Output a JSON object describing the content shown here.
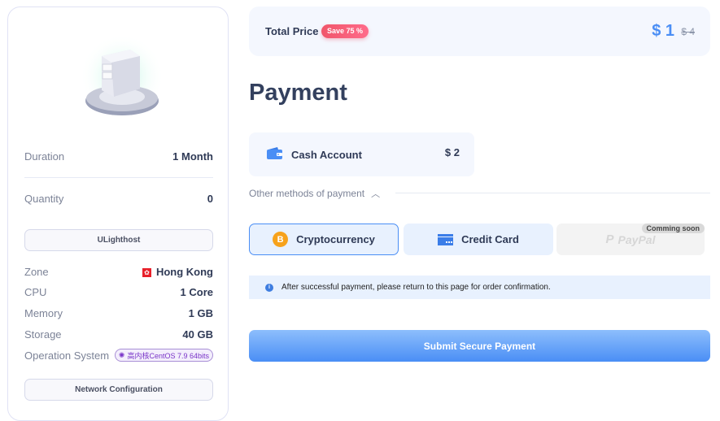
{
  "product": {
    "image_icon": "server-icon",
    "specs_top": [
      {
        "label": "Duration",
        "value": "1 Month"
      },
      {
        "label": "Quantity",
        "value": "0"
      }
    ],
    "provider_button": "ULighthost",
    "specs": [
      {
        "label": "Zone",
        "value": "Hong Kong",
        "flag_icon": "hong-kong-flag-icon"
      },
      {
        "label": "CPU",
        "value": "1 Core"
      },
      {
        "label": "Memory",
        "value": "1 GB"
      },
      {
        "label": "Storage",
        "value": "40 GB"
      },
      {
        "label": "Operation System",
        "value": "高内核CentOS 7.9 64bits"
      }
    ],
    "network_button": "Network Configuration"
  },
  "total": {
    "label": "Total Price",
    "save_badge": "Save 75 %",
    "price": "$ 1",
    "original_price": "$ 4"
  },
  "payment": {
    "title": "Payment",
    "cash_account": {
      "label": "Cash Account",
      "amount": "$ 2",
      "icon": "wallet-icon"
    },
    "other_methods_label": "Other methods of payment",
    "methods": [
      {
        "label": "Cryptocurrency",
        "icon": "bitcoin-icon",
        "selected": true
      },
      {
        "label": "Credit Card",
        "icon": "credit-card-icon",
        "selected": false
      },
      {
        "label": "PayPal",
        "icon": "paypal-icon",
        "disabled": true,
        "badge": "Comming soon"
      }
    ],
    "notice": "After successful payment, please return to this page for order confirmation.",
    "submit_label": "Submit Secure Payment"
  },
  "colors": {
    "accent": "#4a8ef5",
    "save_badge": "#f0566a",
    "text_dark": "#2f3a56",
    "panel_bg": "#f4f7fe"
  }
}
